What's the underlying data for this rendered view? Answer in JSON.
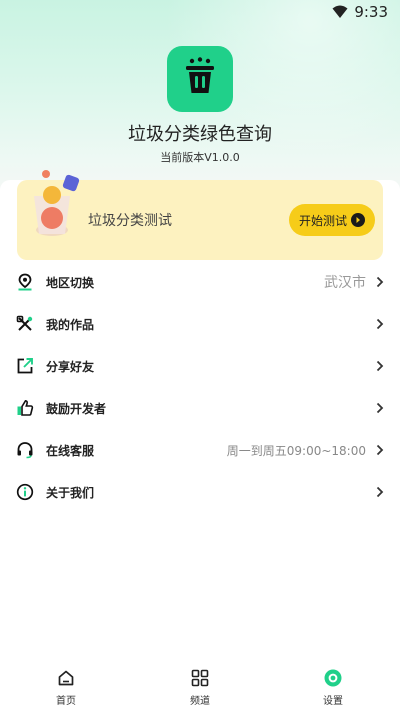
{
  "status_bar": {
    "time": "9:33",
    "wifi_icon": "wifi-icon"
  },
  "header": {
    "logo_icon": "trash-bin-icon",
    "app_name": "垃圾分类绿色查询",
    "version": "当前版本V1.0.0",
    "accent_color": "#20d08a"
  },
  "banner": {
    "title": "垃圾分类测试",
    "button_label": "开始测试",
    "button_color": "#f6cc19",
    "background": "#fdf2c0"
  },
  "menu": {
    "items": [
      {
        "icon": "location-pin-icon",
        "label": "地区切换",
        "value": "武汉市"
      },
      {
        "icon": "tools-icon",
        "label": "我的作品",
        "value": ""
      },
      {
        "icon": "share-icon",
        "label": "分享好友",
        "value": ""
      },
      {
        "icon": "thumbs-up-icon",
        "label": "鼓励开发者",
        "value": ""
      },
      {
        "icon": "headset-icon",
        "label": "在线客服",
        "value": "周一到周五09:00~18:00"
      },
      {
        "icon": "info-icon",
        "label": "关于我们",
        "value": ""
      }
    ]
  },
  "tabbar": {
    "tabs": [
      {
        "icon": "home-icon",
        "label": "首页",
        "active": false
      },
      {
        "icon": "grid-icon",
        "label": "频道",
        "active": false
      },
      {
        "icon": "settings-icon",
        "label": "设置",
        "active": true
      }
    ],
    "active_color": "#20d08a"
  }
}
